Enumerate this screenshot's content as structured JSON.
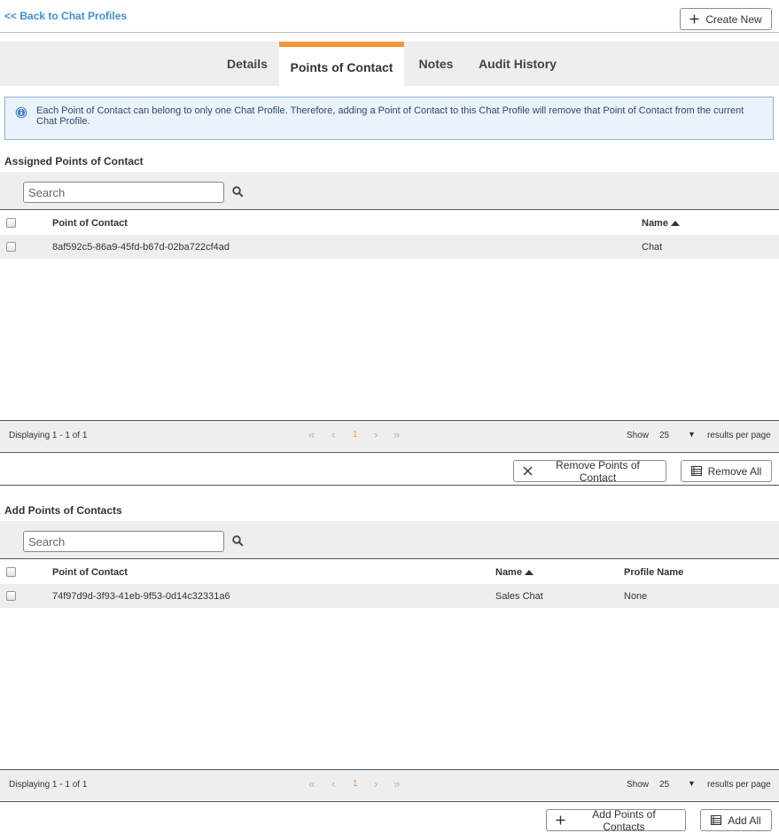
{
  "nav": {
    "back_link": "<< Back to Chat Profiles",
    "create_new": "Create New"
  },
  "tabs": [
    {
      "label": "Details",
      "active": false
    },
    {
      "label": "Points of Contact",
      "active": true
    },
    {
      "label": "Notes",
      "active": false
    },
    {
      "label": "Audit History",
      "active": false
    }
  ],
  "info_text": "Each Point of Contact can belong to only one Chat Profile. Therefore, adding a Point of Contact to this Chat Profile will remove that Point of Contact from the current Chat Profile.",
  "assigned": {
    "title": "Assigned Points of Contact",
    "search_placeholder": "Search",
    "columns": {
      "point_of_contact": "Point of Contact",
      "name": "Name"
    },
    "rows": [
      {
        "point_of_contact": "8af592c5-86a9-45fd-b67d-02ba722cf4ad",
        "name": "Chat"
      }
    ],
    "pager": {
      "displaying": "Displaying 1 - 1 of 1",
      "page": "1",
      "show": "Show",
      "per_page": "25",
      "results_per_page": "results per page"
    },
    "remove_button": "Remove Points of Contact",
    "remove_all_button": "Remove All"
  },
  "add": {
    "title": "Add Points of Contacts",
    "search_placeholder": "Search",
    "columns": {
      "point_of_contact": "Point of Contact",
      "name": "Name",
      "profile_name": "Profile Name"
    },
    "rows": [
      {
        "point_of_contact": "74f97d9d-3f93-41eb-9f53-0d14c32331a6",
        "name": "Sales Chat",
        "profile_name": "None"
      }
    ],
    "pager": {
      "displaying": "Displaying 1 - 1 of 1",
      "page": "1",
      "show": "Show",
      "per_page": "25",
      "results_per_page": "results per page"
    },
    "add_button": "Add Points of Contacts",
    "add_all_button": "Add All"
  },
  "colors": {
    "accent": "#f7953b",
    "link": "#3f8fd2",
    "info_bg": "#eaf2fc",
    "info_border": "#8fb2d8",
    "panel_bg": "#eeeeee"
  },
  "icons": {
    "create": "plus-icon",
    "search": "search-icon",
    "info": "info-icon",
    "remove": "x-icon",
    "all": "list-icon",
    "add": "plus-icon"
  }
}
